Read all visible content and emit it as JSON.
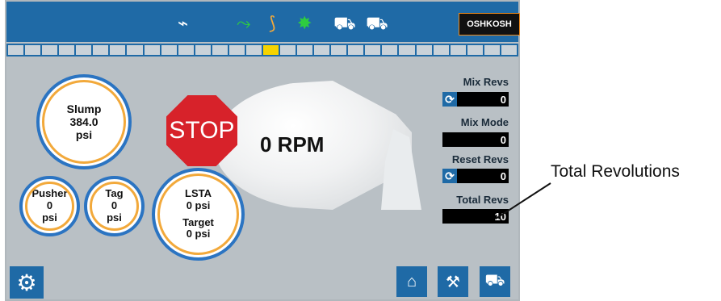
{
  "colors": {
    "panel_bg": "#b9c0c5",
    "accent_blue": "#1f6aa6",
    "gauge_outer": "#2b74c2",
    "gauge_inner": "#f2a93b",
    "stop_red": "#d7222a",
    "indicator_yellow": "#f6d300"
  },
  "top_bar": {
    "icons": [
      "hook-icon",
      "shovel-icon",
      "chute-icon",
      "beacon-icon",
      "truck-unload-icon",
      "truck-dump-icon"
    ],
    "logo_text": "OSHKOSH"
  },
  "indicator": {
    "segments": 30,
    "active_index": 15
  },
  "gauges": {
    "slump": {
      "label": "Slump",
      "value": "384.0",
      "unit": "psi"
    },
    "pusher": {
      "label": "Pusher",
      "value": "0",
      "unit": "psi"
    },
    "tag": {
      "label": "Tag",
      "value": "0",
      "unit": "psi"
    },
    "lsta": {
      "label": "LSTA",
      "value": "0 psi",
      "target_label": "Target",
      "target_value": "0 psi"
    }
  },
  "drum": {
    "stop_text": "STOP",
    "rpm_text": "0 RPM"
  },
  "readouts": {
    "mix_revs": {
      "label": "Mix Revs",
      "value": "0"
    },
    "mix_mode": {
      "label": "Mix Mode",
      "value": "0"
    },
    "reset_revs": {
      "label": "Reset Revs",
      "value": "0"
    },
    "total_revs": {
      "label": "Total Revs",
      "value": "10"
    }
  },
  "bottom_bar": {
    "buttons": [
      "settings-gear-icon",
      "chute-up-icon",
      "operator-icon",
      "truck-status-icon"
    ]
  },
  "callout": {
    "text": "Total Revolutions"
  }
}
